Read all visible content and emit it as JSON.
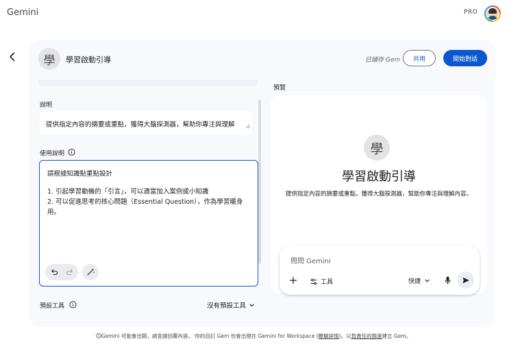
{
  "app": {
    "brand": "Gemini",
    "plan_badge": "PRO"
  },
  "header": {
    "gem_icon_char": "學",
    "gem_name": "學習啟動引導",
    "saved_status": "已儲存 Gem",
    "share_label": "共用",
    "start_label": "開始對話"
  },
  "editor": {
    "description_label": "說明",
    "description_value": "提供指定內容的摘要或重點，獲得大腦探測器，幫助你專注與理解",
    "instructions_label": "使用說明",
    "instructions_lines": [
      "請根據知識點重點設計",
      "1. 引起學習動機的「引言」，可以適當加入案例或小知識",
      "2. 可以促進思考的核心問題（Essential Question），作為學習暖身",
      "用。"
    ],
    "default_tools_label": "預設工具",
    "default_tools_value": "沒有預設工具"
  },
  "preview": {
    "label": "預覽",
    "icon_char": "學",
    "title": "學習啟動引導",
    "description": "提供指定內容的摘要或重點，獲得大腦探測器，幫助你專注與理解內容。",
    "chat": {
      "placeholder": "問問 Gemini",
      "tools_label": "工具",
      "mode_label": "快捷"
    }
  },
  "footer": {
    "text_1": "Gemini 可能會出錯，請查證回覆內容。 你的自訂 Gem 也會出現在 Gemini for Workspace (",
    "link_1": "瞭解詳情",
    "text_2": ")。以",
    "link_2": "負責任的態度",
    "text_3": "建立 Gem。"
  },
  "colors": {
    "accent": "#0b57d0",
    "panel_bg": "#f7f9fc",
    "text": "#1f1f1f",
    "muted": "#5f6368"
  },
  "icons": [
    "back-arrow-icon",
    "info-icon",
    "undo-icon",
    "redo-icon",
    "magic-wand-icon",
    "chevron-down-icon",
    "plus-icon",
    "tools-icon",
    "mic-icon",
    "send-icon"
  ]
}
